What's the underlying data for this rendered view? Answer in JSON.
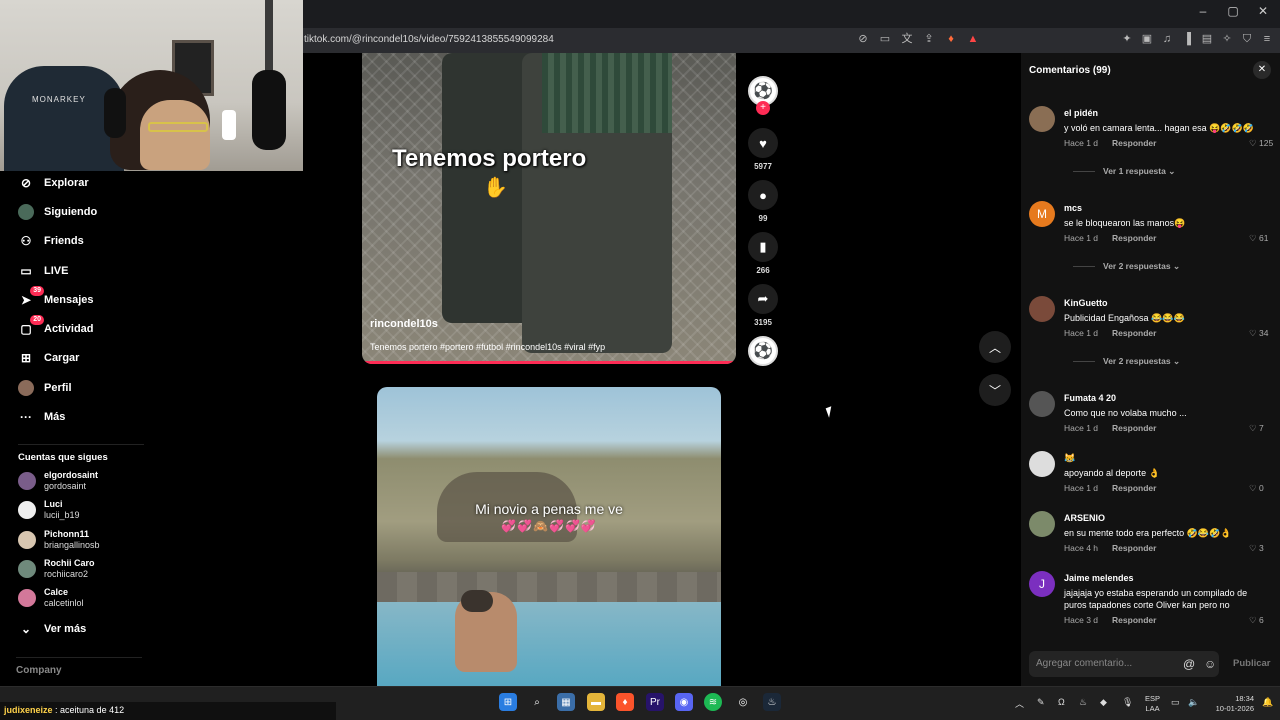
{
  "browser": {
    "url": "tiktok.com/@rincondel10s/video/7592413855549099284"
  },
  "sidebar": {
    "items": [
      {
        "label": "Explorar",
        "icon": "compass-icon"
      },
      {
        "label": "Siguiendo",
        "icon": "avatar-icon"
      },
      {
        "label": "Friends",
        "icon": "friends-icon"
      },
      {
        "label": "LIVE",
        "icon": "live-icon"
      },
      {
        "label": "Mensajes",
        "icon": "messages-icon",
        "badge": "39"
      },
      {
        "label": "Actividad",
        "icon": "activity-icon",
        "badge": "20"
      },
      {
        "label": "Cargar",
        "icon": "upload-icon"
      },
      {
        "label": "Perfil",
        "icon": "profile-icon"
      },
      {
        "label": "Más",
        "icon": "more-icon"
      }
    ],
    "following_title": "Cuentas que sigues",
    "accounts": [
      {
        "name": "elgordosaint",
        "user": "gordosaint"
      },
      {
        "name": "Luci",
        "user": "lucii_b19"
      },
      {
        "name": "Pichonn11",
        "user": "briangallinosb"
      },
      {
        "name": "Rochii Caro",
        "user": "rochiicaro2"
      },
      {
        "name": "Calce",
        "user": "calcetinlol"
      }
    ],
    "see_more": "Ver más",
    "company": "Company"
  },
  "video1": {
    "caption": "Tenemos portero",
    "username": "rincondel10s",
    "description": "Tenemos portero #portero #futbol #rincondel10s #viral #fyp",
    "likes": "5977",
    "comments": "99",
    "saves": "266",
    "shares": "3195"
  },
  "video2": {
    "caption": "Mi novio a penas me ve",
    "emoji": "💞💞🙈💞💞💞"
  },
  "comments_panel": {
    "title": "Comentarios (99)",
    "reply_label": "Responder",
    "items": [
      {
        "user": "el pidén",
        "text": "y voló en camara lenta... hagan esa 😝🤣🤣🤣",
        "time": "Hace 1 d",
        "likes": "125",
        "replies": "Ver 1 respuesta"
      },
      {
        "user": "mcs",
        "text": "se le bloquearon las manos😝",
        "time": "Hace 1 d",
        "likes": "61",
        "replies": "Ver 2 respuestas"
      },
      {
        "user": "KinGuetto",
        "text": "Publicidad Engañosa 😂😂😂",
        "time": "Hace 1 d",
        "likes": "34",
        "replies": "Ver 2 respuestas"
      },
      {
        "user": "Fumata 4 20",
        "text": "Como que no volaba mucho ...",
        "time": "Hace 1 d",
        "likes": "7"
      },
      {
        "user": "😹",
        "text": "apoyando al deporte 👌",
        "time": "Hace 1 d",
        "likes": "0"
      },
      {
        "user": "ARSENIO",
        "text": "en su mente todo era perfecto 🤣😂🤣👌",
        "time": "Hace 4 h",
        "likes": "3"
      },
      {
        "user": "Jaime melendes",
        "text": "jajajaja yo estaba esperando un compilado de puros tapadones corte Oliver kan pero no",
        "time": "Hace 3 d",
        "likes": "6"
      }
    ],
    "input_placeholder": "Agregar comentario...",
    "publish": "Publicar"
  },
  "taskbar": {
    "chat_user": "judixeneize",
    "chat_text": ": aceituna de 412",
    "lang": "ESP",
    "lang2": "LAA",
    "time": "18:34",
    "date": "10-01-2026"
  }
}
